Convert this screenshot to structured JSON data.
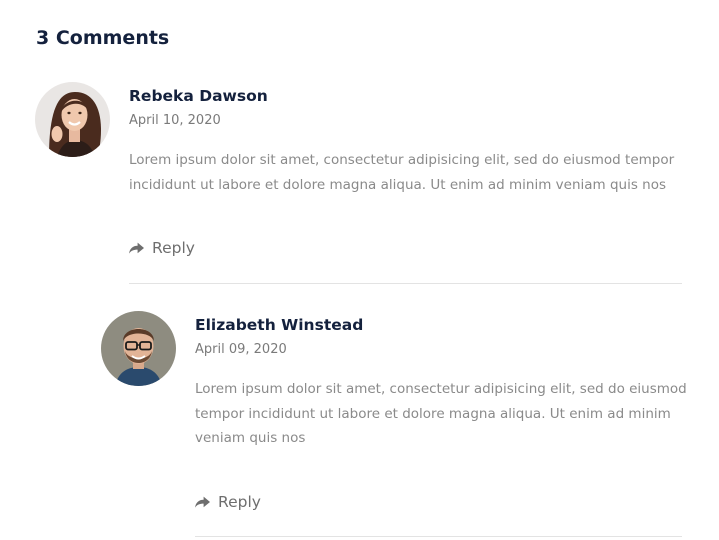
{
  "comments_section": {
    "heading": "3 Comments",
    "comments": [
      {
        "author": "Rebeka Dawson",
        "date": "April 10, 2020",
        "text": "Lorem ipsum dolor sit amet, consectetur adipisicing elit, sed do eiusmod tempor incididunt ut labore et dolore magna aliqua. Ut enim ad minim veniam quis nos",
        "reply_label": "Reply",
        "reply_icon": "reply-arrow-icon"
      },
      {
        "author": "Elizabeth Winstead",
        "date": "April 09, 2020",
        "text": "Lorem ipsum dolor sit amet, consectetur adipisicing elit, sed do eiusmod tempor incididunt ut labore et dolore magna aliqua. Ut enim ad minim veniam quis nos",
        "reply_label": "Reply",
        "reply_icon": "reply-arrow-icon"
      }
    ]
  },
  "colors": {
    "heading": "#14213d",
    "muted_text": "#8a8a8a",
    "divider": "#e3e3e3"
  }
}
